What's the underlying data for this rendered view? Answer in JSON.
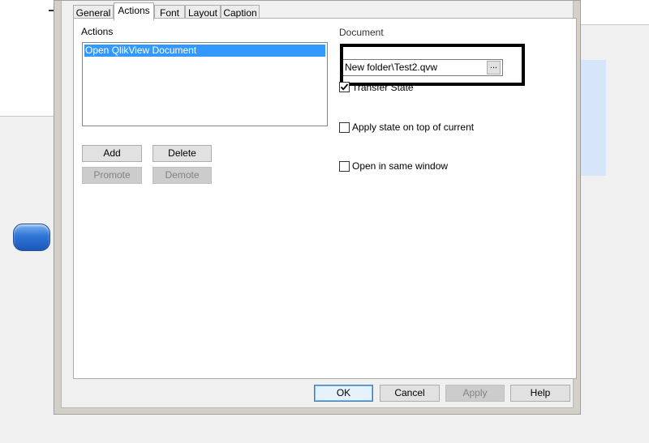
{
  "dialog": {
    "tabs": [
      {
        "label": "General"
      },
      {
        "label": "Actions"
      },
      {
        "label": "Font"
      },
      {
        "label": "Layout"
      },
      {
        "label": "Caption"
      }
    ],
    "active_tab": "Actions"
  },
  "actions_panel": {
    "label": "Actions",
    "items": [
      "Open QlikView Document"
    ],
    "add_label": "Add",
    "delete_label": "Delete",
    "promote_label": "Promote",
    "demote_label": "Demote"
  },
  "document": {
    "label": "Document",
    "value": "New folder\\Test2.qvw",
    "browse_label": "..."
  },
  "options": {
    "transfer_state": {
      "label": "Transfer State",
      "checked": true
    },
    "apply_state_on_top": {
      "label": "Apply state on top of current",
      "checked": false
    },
    "open_in_same_window": {
      "label": "Open in same window",
      "checked": false
    }
  },
  "footer": {
    "ok_label": "OK",
    "cancel_label": "Cancel",
    "apply_label": "Apply",
    "help_label": "Help"
  },
  "colors": {
    "selection": "#3399ff",
    "highlight_border": "#000000",
    "background_accent": "#d6e6f8",
    "pill_blue": "#2f75d6"
  }
}
